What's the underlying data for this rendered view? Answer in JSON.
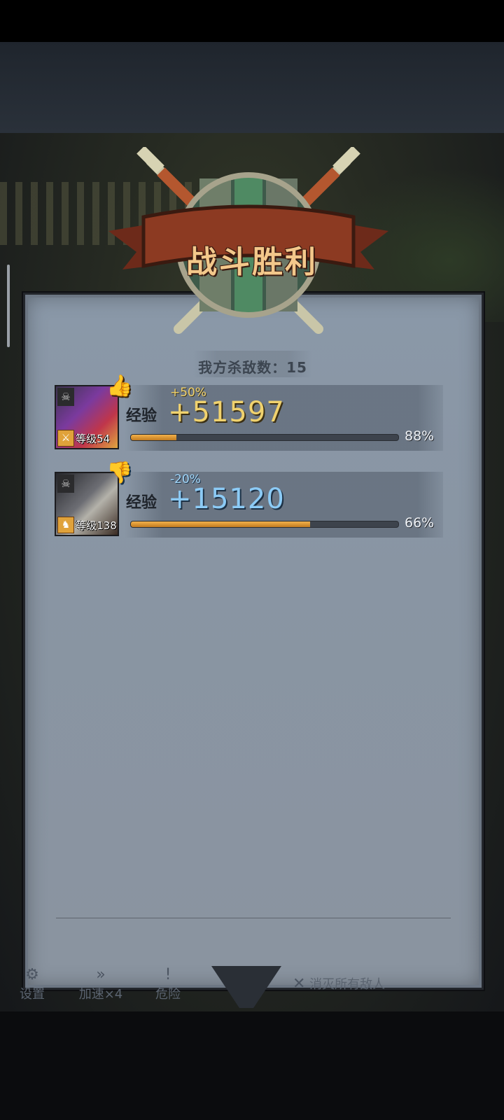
{
  "title": "战斗胜利",
  "kill_count": {
    "label": "我方杀敌数：15"
  },
  "heroes": [
    {
      "level_label": "等级54",
      "bonus": "+50%",
      "exp_label": "经验",
      "exp_gain": "+51597",
      "progress": 0.17,
      "percent": "88%",
      "trend": "up"
    },
    {
      "level_label": "等级138",
      "bonus": "-20%",
      "exp_label": "经验",
      "exp_gain": "+15120",
      "progress": 0.67,
      "percent": "66%",
      "trend": "down"
    }
  ],
  "hud": {
    "settings": "设置",
    "speed": "加速×4",
    "danger": "危险",
    "eliminate": "消灭所有敌人"
  },
  "colors": {
    "gold": "#f0d26e",
    "blue": "#8ccbf6",
    "bar": "#f3b14a"
  }
}
